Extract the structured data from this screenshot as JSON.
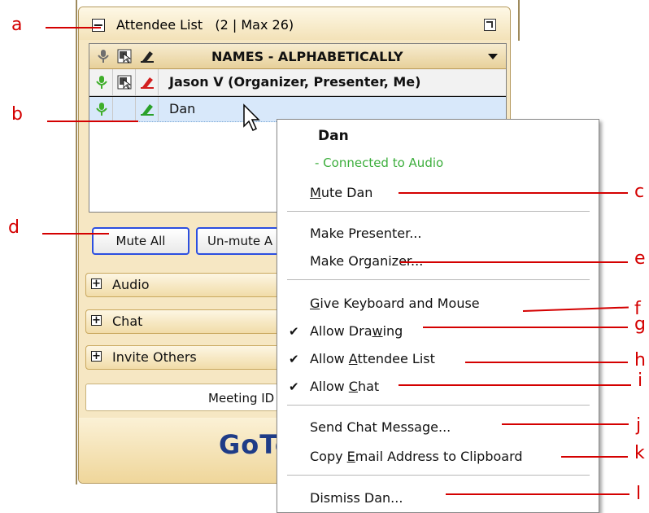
{
  "attendee_panel": {
    "title": "Attendee List",
    "count": "(2 | Max 26)",
    "expanded_symbol": "−",
    "sort_label": "NAMES - ALPHABETICALLY",
    "attendees": [
      {
        "name": "Jason V (Organizer, Presenter, Me)",
        "bold": true
      },
      {
        "name": "Dan",
        "bold": false
      }
    ],
    "mute_all": "Mute All",
    "unmute_all": "Un-mute A",
    "sections": [
      {
        "label": "Audio",
        "symbol": "+"
      },
      {
        "label": "Chat",
        "symbol": "+"
      },
      {
        "label": "Invite Others",
        "symbol": "+"
      }
    ],
    "meeting_id": "Meeting ID",
    "brand": "GoTo"
  },
  "context_menu": {
    "name": "Dan",
    "status": "- Connected to Audio",
    "items": {
      "mute_prefix": "M",
      "mute_rest": "ute Dan",
      "make_presenter": "Make Presenter...",
      "make_organizer": "Make Organizer...",
      "give_prefix": "G",
      "give_rest": "ive Keyboard and Mouse",
      "draw_a": "Allow Dra",
      "draw_u": "w",
      "draw_b": "ing",
      "att_a": "Allow ",
      "att_u": "A",
      "att_b": "ttendee List",
      "chat_a": "Allow ",
      "chat_u": "C",
      "chat_b": "hat",
      "send_chat": "Send Chat Message...",
      "copy_a": "Copy ",
      "copy_u": "E",
      "copy_b": "mail Address to Clipboard",
      "dismiss": "Dismiss Dan..."
    },
    "check_glyph": "✔"
  },
  "callouts": {
    "a": "a",
    "b": "b",
    "c": "c",
    "d": "d",
    "e": "e",
    "f": "f",
    "g": "g",
    "h": "h",
    "i": "i",
    "j": "j",
    "k": "k",
    "l": "l"
  },
  "colors": {
    "accent_red": "#d40000",
    "status_green": "#3cae3c",
    "brand_blue": "#1f3c87"
  }
}
